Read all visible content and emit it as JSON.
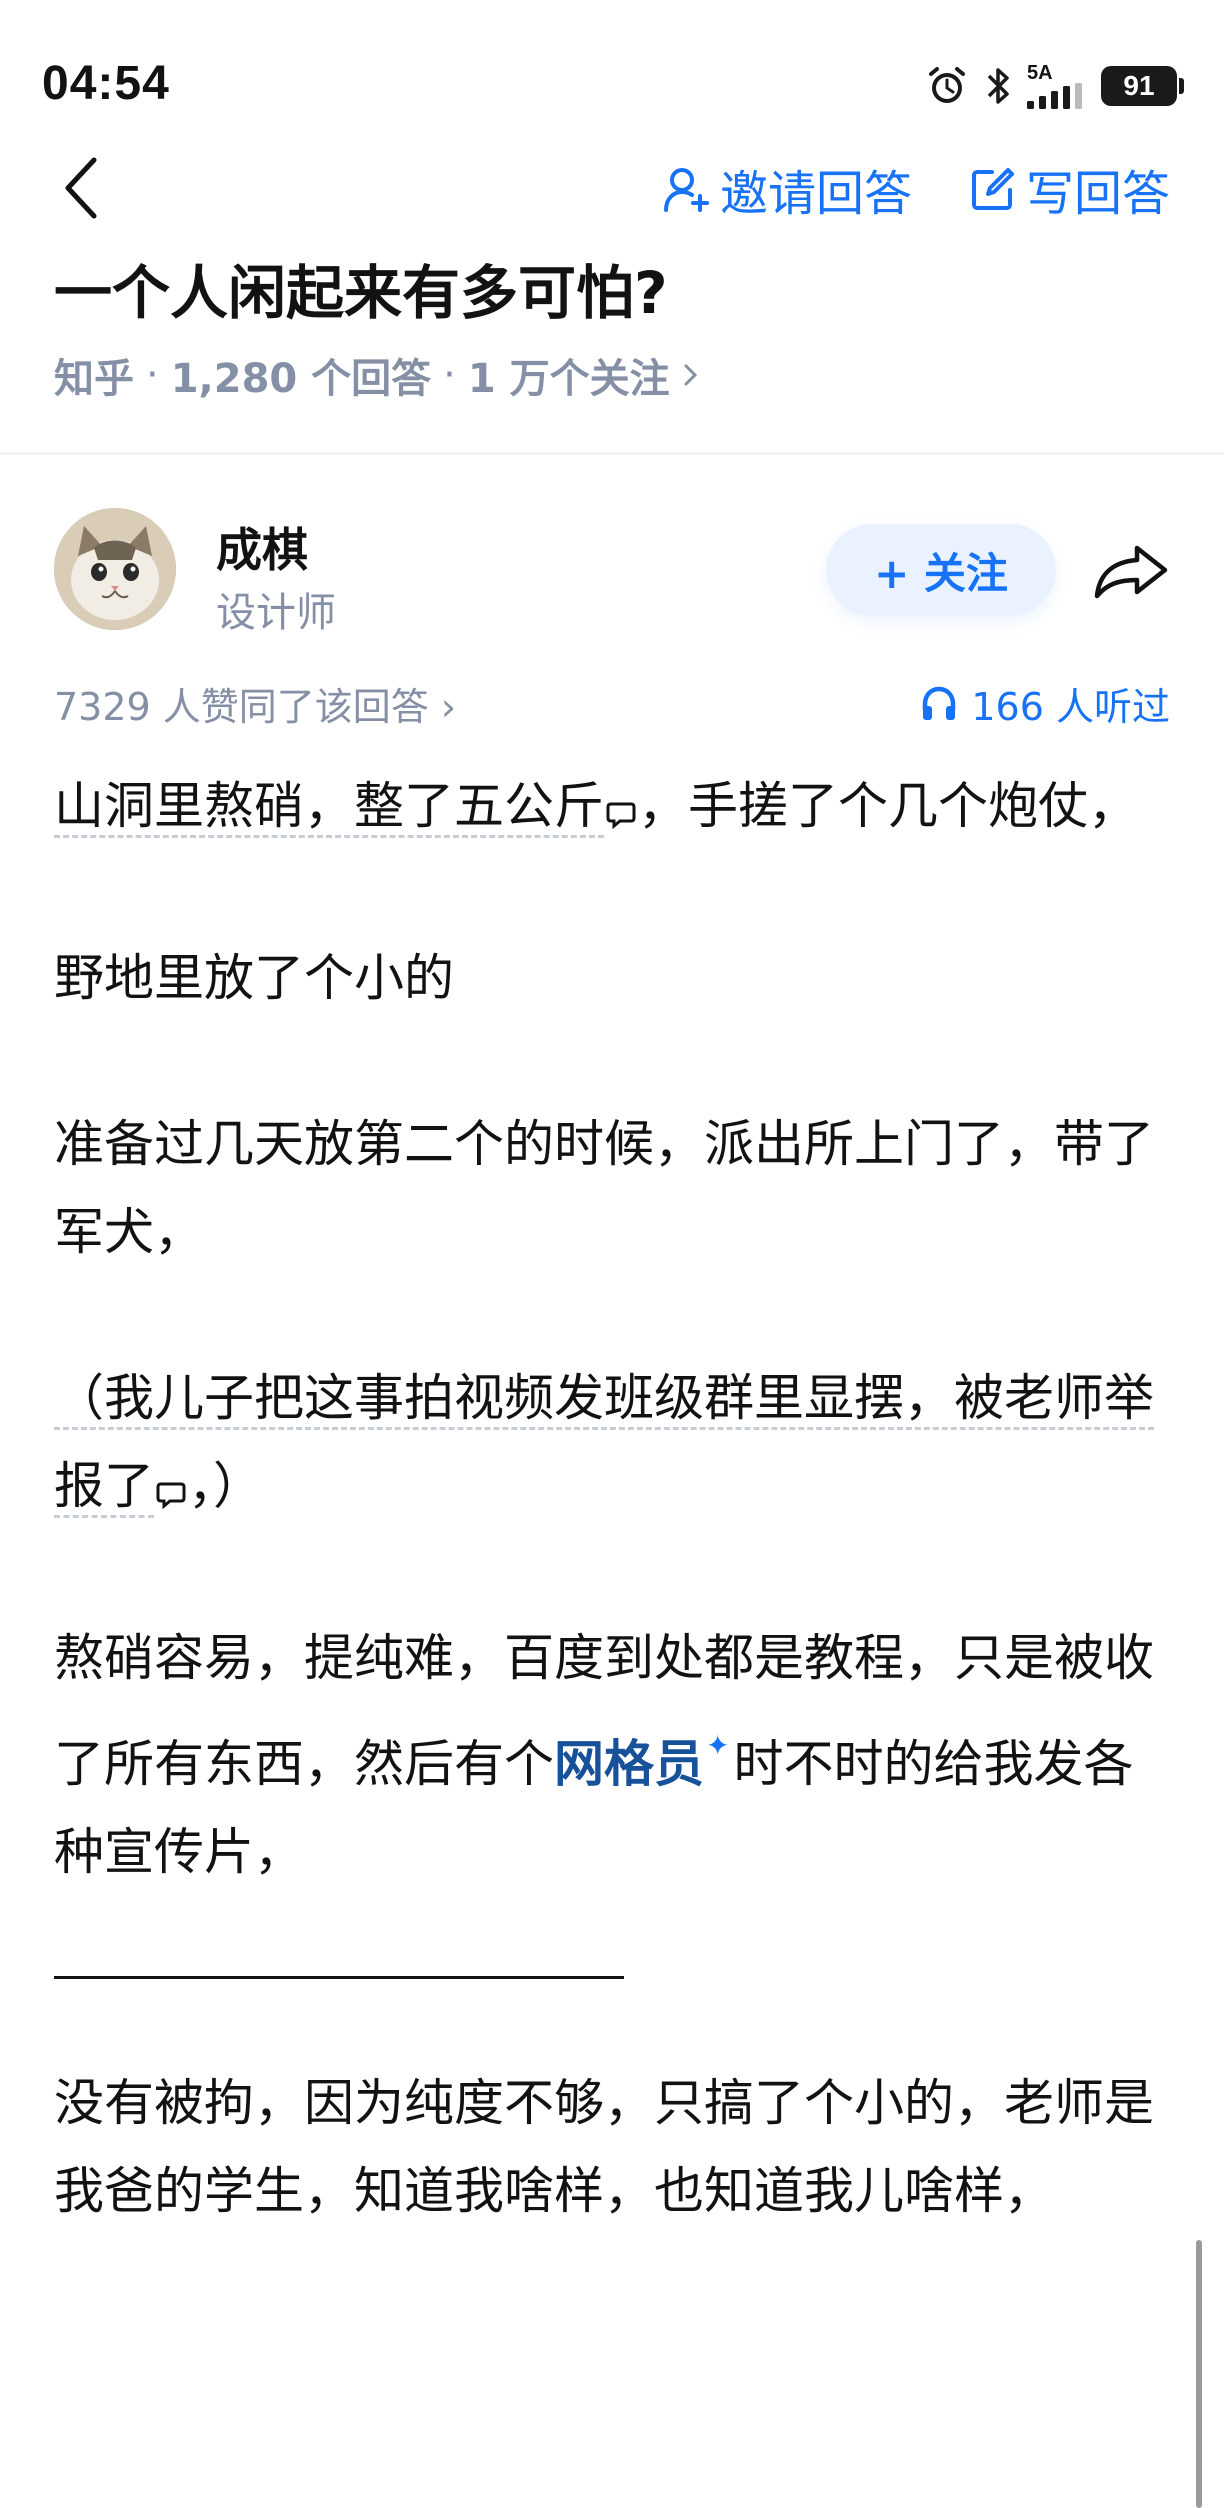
{
  "status_bar": {
    "time": "04:54",
    "network": "5A",
    "battery": "91"
  },
  "nav": {
    "invite_label": "邀请回答",
    "write_label": "写回答"
  },
  "question": {
    "title": "一个人闲起来有多可怕?",
    "source": "知乎",
    "answers": "1,280 个回答",
    "followers": "1 万个关注",
    "sep": "·"
  },
  "author": {
    "name": "成棋",
    "title": "设计师",
    "follow_label": "+ 关注"
  },
  "stats": {
    "votes": "7329 人赞同了该回答 ›",
    "listens": "166 人听过"
  },
  "content": {
    "p1_part1": "山洞里熬硝，整了五公斤",
    "p1_part2": "，手搓了个几个炮仗，",
    "p2": "野地里放了个小的",
    "p3": "准备过几天放第二个的时候，派出所上门了，带了军犬，",
    "p4_part1": "（我儿子把这事拍视频发班级群里显摆，被老师举报了",
    "p4_part2": "，）",
    "p5_part1": "熬硝容易，提纯难，百度到处都是教程，只是被收了所有东西，然后有个",
    "p5_keyword": "网格员",
    "p5_part2": "时不时的给我发各种宣传片，",
    "p6": "没有被拘，因为纯度不够，只搞了个小的，老师是我爸的学生，知道我啥样，也知道我儿啥样，"
  },
  "colors": {
    "accent": "#1772f6",
    "keyword": "#175199",
    "meta": "#8590a6",
    "text": "#121212"
  },
  "icons": {
    "back": "chevron-left-icon",
    "invite": "person-plus-icon",
    "write": "edit-icon",
    "share": "share-arrow-icon",
    "listens": "headphones-icon",
    "comment": "comment-bubble-icon"
  }
}
